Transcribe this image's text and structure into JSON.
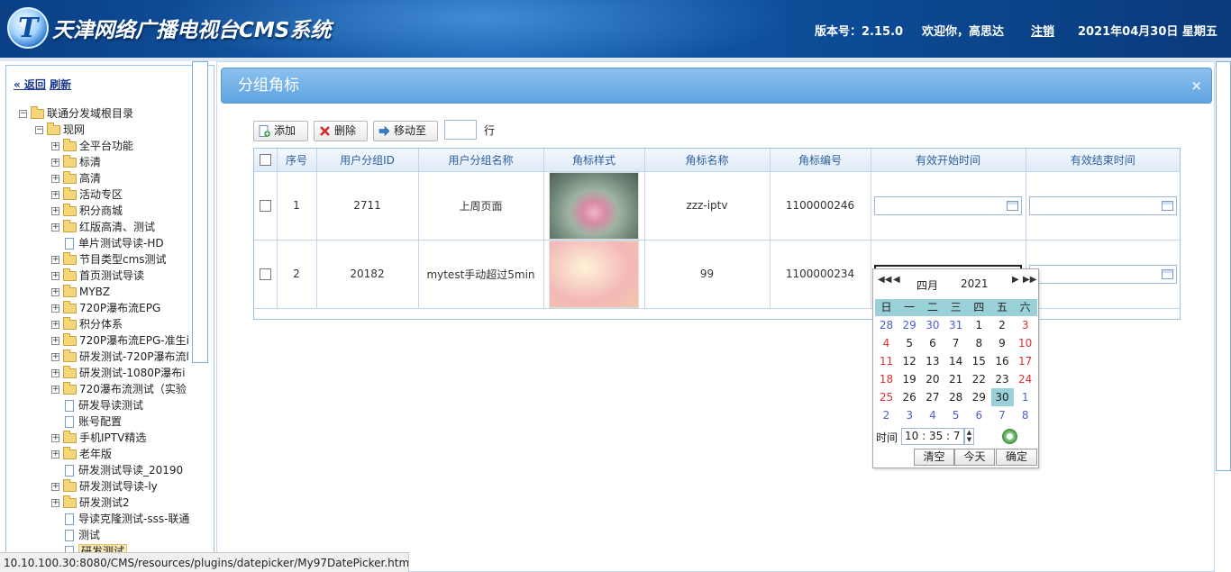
{
  "header": {
    "logo_letter": "T",
    "title": "天津网络广播电视台CMS系统",
    "version": "版本号：2.15.0",
    "welcome": "欢迎你，高思达",
    "logout": "注销",
    "datetime": "2021年04月30日 星期五"
  },
  "sidebar": {
    "back": "« 返回",
    "refresh": "刷新",
    "tree": [
      {
        "label": "联通分发域根目录",
        "icon": "folder-icon",
        "toggle": "minus"
      },
      {
        "label": "现网",
        "icon": "folder-icon",
        "toggle": "minus"
      },
      {
        "label": "全平台功能",
        "icon": "folder-icon",
        "toggle": "plus"
      },
      {
        "label": "标清",
        "icon": "folder-icon",
        "toggle": "plus"
      },
      {
        "label": "高清",
        "icon": "folder-icon",
        "toggle": "plus"
      },
      {
        "label": "活动专区",
        "icon": "folder-icon",
        "toggle": "plus"
      },
      {
        "label": "积分商城",
        "icon": "folder-icon",
        "toggle": "plus"
      },
      {
        "label": "红版高清、测试",
        "icon": "folder-icon",
        "toggle": "plus"
      },
      {
        "label": "单片测试导读-HD",
        "icon": "document-icon",
        "toggle": ""
      },
      {
        "label": "节目类型cms测试",
        "icon": "folder-icon",
        "toggle": "plus"
      },
      {
        "label": "首页测试导读",
        "icon": "folder-icon",
        "toggle": "plus"
      },
      {
        "label": "MYBZ",
        "icon": "folder-icon",
        "toggle": "plus"
      },
      {
        "label": "720P瀑布流EPG",
        "icon": "folder-icon",
        "toggle": "plus"
      },
      {
        "label": "积分体系",
        "icon": "folder-icon",
        "toggle": "plus"
      },
      {
        "label": "720P瀑布流EPG-准生i",
        "icon": "folder-icon",
        "toggle": "plus"
      },
      {
        "label": "研发测试-720P瀑布流l",
        "icon": "folder-icon",
        "toggle": "plus"
      },
      {
        "label": "研发测试-1080P瀑布i",
        "icon": "folder-icon",
        "toggle": "plus"
      },
      {
        "label": "720瀑布流测试（实验",
        "icon": "folder-icon",
        "toggle": "plus"
      },
      {
        "label": "研发导读测试",
        "icon": "document-icon",
        "toggle": ""
      },
      {
        "label": "账号配置",
        "icon": "document-icon",
        "toggle": ""
      },
      {
        "label": "手机IPTV精选",
        "icon": "folder-icon",
        "toggle": "plus"
      },
      {
        "label": "老年版",
        "icon": "folder-icon",
        "toggle": "plus"
      },
      {
        "label": "研发测试导读_20190",
        "icon": "document-icon",
        "toggle": ""
      },
      {
        "label": "研发测试导读-ly",
        "icon": "folder-icon",
        "toggle": "plus"
      },
      {
        "label": "研发测试2",
        "icon": "folder-icon",
        "toggle": "plus"
      },
      {
        "label": "导读克隆测试-sss-联通",
        "icon": "document-icon",
        "toggle": ""
      },
      {
        "label": "测试",
        "icon": "document-icon",
        "toggle": ""
      },
      {
        "label": "研发测试",
        "icon": "document-icon",
        "toggle": "",
        "selected": true
      }
    ]
  },
  "statusbar": "10.10.100.30:8080/CMS/resources/plugins/datepicker/My97DatePicker.htm...",
  "panel": {
    "title": "分组角标",
    "close": "×"
  },
  "toolbar": {
    "add": "添加",
    "delete": "删除",
    "move": "移动至",
    "rows_value": "",
    "rows_label": "行"
  },
  "table": {
    "headers": [
      "序号",
      "用户分组ID",
      "用户分组名称",
      "角标样式",
      "角标名称",
      "角标编号",
      "有效开始时间",
      "有效结束时间"
    ],
    "rows": [
      {
        "no": "1",
        "group_id": "2711",
        "group_name": "上周页面",
        "badge_name": "zzz-iptv",
        "badge_code": "1100000246",
        "start": "",
        "end": ""
      },
      {
        "no": "2",
        "group_id": "20182",
        "group_name": "mytest手动超过5min",
        "badge_name": "99",
        "badge_code": "1100000234",
        "start": "",
        "end": ""
      }
    ]
  },
  "datepicker": {
    "month": "四月",
    "year": "2021",
    "weekdays": [
      "日",
      "一",
      "二",
      "三",
      "四",
      "五",
      "六"
    ],
    "days": [
      "28",
      "29",
      "30",
      "31",
      "1",
      "2",
      "3",
      "4",
      "5",
      "6",
      "7",
      "8",
      "9",
      "10",
      "11",
      "12",
      "13",
      "14",
      "15",
      "16",
      "17",
      "18",
      "19",
      "20",
      "21",
      "22",
      "23",
      "24",
      "25",
      "26",
      "27",
      "28",
      "29",
      "30",
      "1",
      "2",
      "3",
      "4",
      "5",
      "6",
      "7",
      "8"
    ],
    "other_month": [
      0,
      1,
      2,
      3,
      34,
      35,
      36,
      37,
      38,
      39,
      40,
      41
    ],
    "today_index": 33,
    "time_label": "时间",
    "time_value": "10 : 35 : 7",
    "clear": "清空",
    "today": "今天",
    "ok": "确定",
    "colors": {
      "header_bg": "#9ad0d8",
      "weekend": "#e03030",
      "other_month": "#4c5fd0"
    }
  }
}
